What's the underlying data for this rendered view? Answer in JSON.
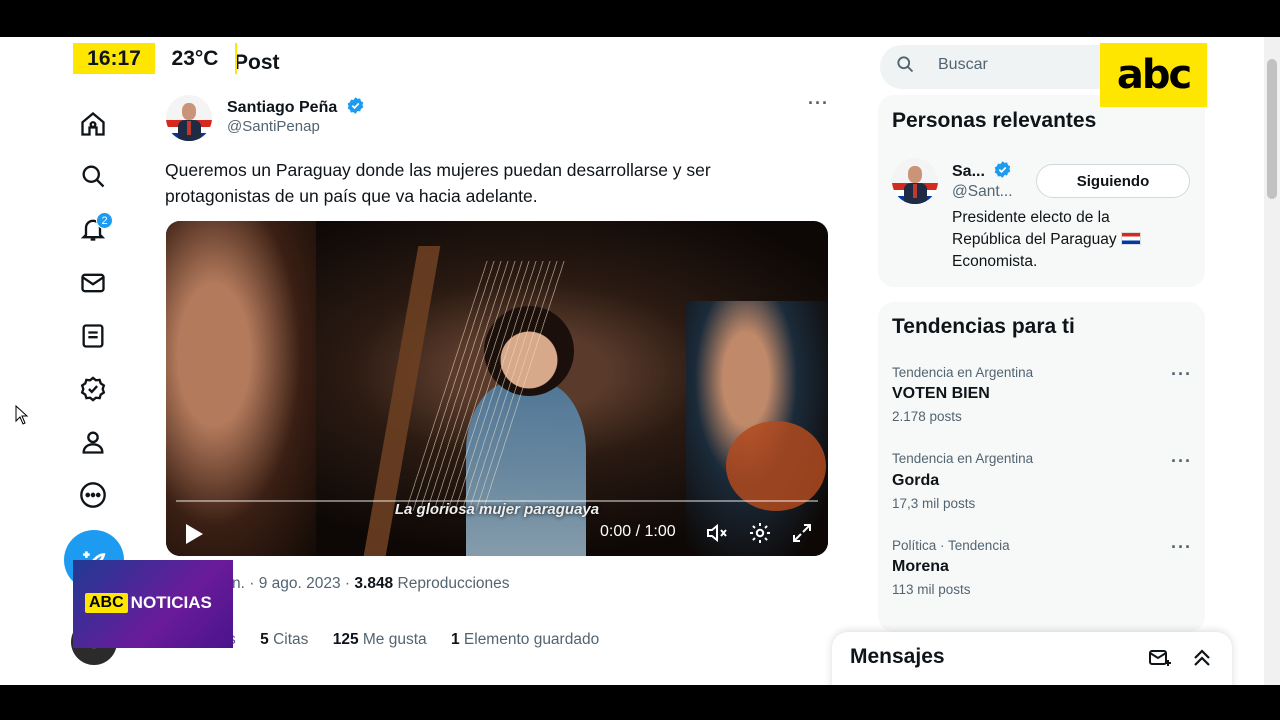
{
  "overlay": {
    "clock": "16:17",
    "temperature": "23°C",
    "logo": "abc",
    "news_badge_abc": "ABC",
    "news_badge_label": "NOTICIAS"
  },
  "page": {
    "header_title": "Post"
  },
  "nav": {
    "notification_count": "2",
    "items": [
      "home-icon",
      "search-icon",
      "bell-icon",
      "mail-icon",
      "lists-icon",
      "verified-icon",
      "profile-icon",
      "more-icon"
    ]
  },
  "post": {
    "author_name": "Santiago Peña",
    "author_handle": "@SantiPenap",
    "text": "Queremos un Paraguay donde las mujeres puedan desarrollarse y ser protagonistas de un país que va hacia adelante.",
    "video": {
      "caption": "La gloriosa mujer paraguaya",
      "time": "0:00 / 1:00"
    },
    "meta_time_fragment": "n.",
    "meta_date": "· 9 ago. 2023 ·",
    "views_count": "3.848",
    "views_label": "Reproducciones",
    "stats": {
      "reposts_fragment": "sts",
      "quotes_count": "5",
      "quotes_label": "Citas",
      "likes_count": "125",
      "likes_label": "Me gusta",
      "saves_count": "1",
      "saves_label": "Elemento guardado"
    }
  },
  "sidebar": {
    "search_placeholder": "Buscar",
    "relevant": {
      "title": "Personas relevantes",
      "name": "Sa...",
      "handle": "@Sant...",
      "follow_label": "Siguiendo",
      "bio_line1": "Presidente electo de la",
      "bio_line2": "República del Paraguay",
      "bio_line3": "Economista."
    },
    "trends": {
      "title": "Tendencias para ti",
      "items": [
        {
          "context": "Tendencia en Argentina",
          "name": "VOTEN BIEN",
          "count": "2.178 posts"
        },
        {
          "context": "Tendencia en Argentina",
          "name": "Gorda",
          "count": "17,3 mil posts"
        },
        {
          "context": "Política · Tendencia",
          "name": "Morena",
          "count": "113 mil posts"
        }
      ]
    },
    "messages_title": "Mensajes"
  }
}
